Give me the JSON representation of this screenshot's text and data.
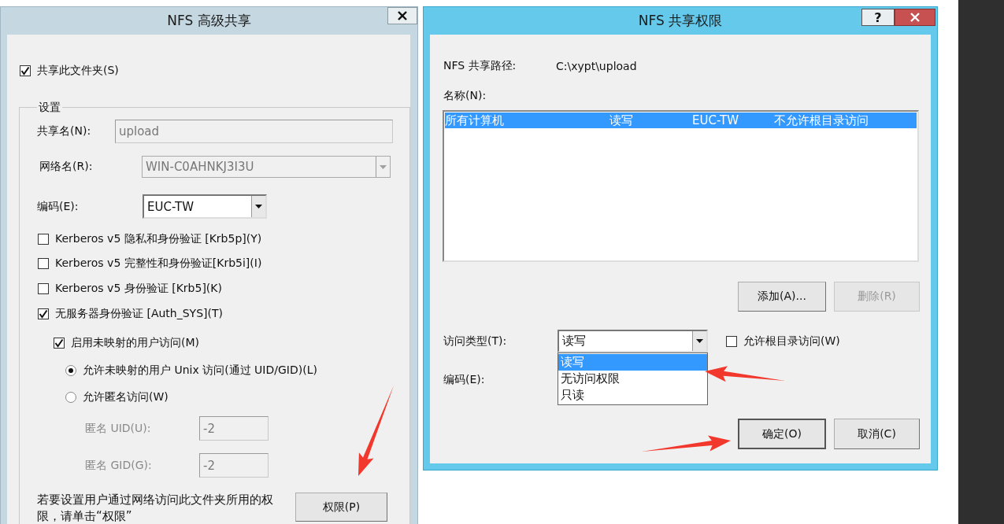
{
  "advanced_sharing_dialog": {
    "title": "NFS 高级共享",
    "share_folder": {
      "label": "共享此文件夹(S)",
      "checked": true
    },
    "settings_group": {
      "title": "设置",
      "share_name": {
        "label": "共享名(N):",
        "value": "upload",
        "disabled": true
      },
      "network_name": {
        "label": "网络名(R):",
        "value": "WIN-C0AHNKJ3I3U",
        "disabled": true
      },
      "encoding": {
        "label": "编码(E):",
        "value": "EUC-TW",
        "disabled": false
      },
      "auth_options": [
        {
          "label": "Kerberos v5 隐私和身份验证 [Krb5p](Y)",
          "checked": false
        },
        {
          "label": "Kerberos v5 完整性和身份验证[Krb5i](I)",
          "checked": false
        },
        {
          "label": "Kerberos v5 身份验证 [Krb5](K)",
          "checked": false
        },
        {
          "label": "无服务器身份验证 [Auth_SYS](T)",
          "checked": true
        }
      ],
      "unmapped_access": {
        "label": "启用未映射的用户访问(M)",
        "checked": true
      },
      "access_modes": [
        {
          "label": "允许未映射的用户 Unix 访问(通过 UID/GID)(L)",
          "selected": true
        },
        {
          "label": "允许匿名访问(W)",
          "selected": false
        }
      ],
      "anonymous_ids": [
        {
          "label": "匿名 UID(U):",
          "value": "-2",
          "disabled": true
        },
        {
          "label": "匿名 GID(G):",
          "value": "-2",
          "disabled": true
        }
      ],
      "permissions_hint": "若要设置用户通过网络访问此文件夹所用的权限，请单击“权限”",
      "permissions_button": "权限(P)"
    }
  },
  "permissions_dialog": {
    "title": "NFS 共享权限",
    "help_button": "?",
    "path_label": "NFS 共享路径:",
    "path_value": "C:\\xypt\\upload",
    "names_label": "名称(N):",
    "names": [
      {
        "cells": [
          "所有计算机",
          "读写",
          "EUC-TW",
          "不允许根目录访问"
        ],
        "selected": true
      }
    ],
    "add_button": {
      "label": "添加(A)...",
      "disabled": false
    },
    "remove_button": {
      "label": "删除(R)",
      "disabled": true
    },
    "access_type": {
      "label": "访问类型(T):",
      "value": "读写",
      "expanded": true,
      "options": [
        {
          "label": "读写",
          "selected": true
        },
        {
          "label": "无访问权限",
          "selected": false
        },
        {
          "label": "只读",
          "selected": false
        }
      ]
    },
    "allow_root": {
      "label": "允许根目录访问(W)",
      "checked": false
    },
    "encoding_label": "编码(E):",
    "ok_button": "确定(O)",
    "cancel_button": "取消(C)"
  }
}
